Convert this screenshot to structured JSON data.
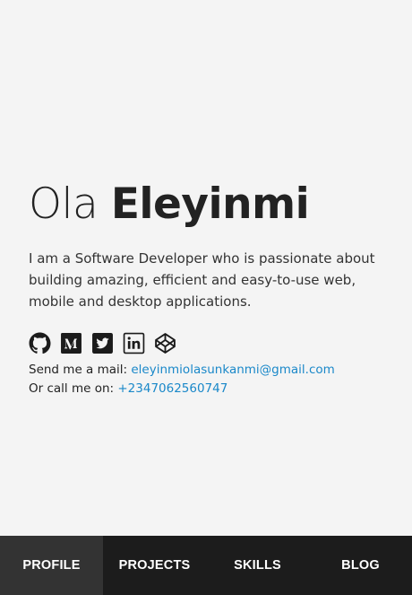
{
  "profile": {
    "first_name": "Ola",
    "last_name": "Eleyinmi",
    "bio": "I am a Software Developer who is passionate about building amazing, efficient and easy-to-use web, mobile and desktop applications.",
    "socials": [
      {
        "icon": "github-icon"
      },
      {
        "icon": "medium-icon"
      },
      {
        "icon": "twitter-icon"
      },
      {
        "icon": "linkedin-icon"
      },
      {
        "icon": "codepen-icon"
      }
    ],
    "mail_label": "Send me a mail:",
    "email": "eleyinmiolasunkanmi@gmail.com",
    "call_label": "Or call me on:",
    "phone": "+2347062560747"
  },
  "nav": {
    "items": [
      "PROFILE",
      "PROJECTS",
      "SKILLS",
      "BLOG"
    ],
    "active": "PROFILE"
  },
  "colors": {
    "background": "#f4f4f4",
    "link": "#1a88c9",
    "nav_bg": "#1c1c1c",
    "nav_active": "#333333"
  }
}
